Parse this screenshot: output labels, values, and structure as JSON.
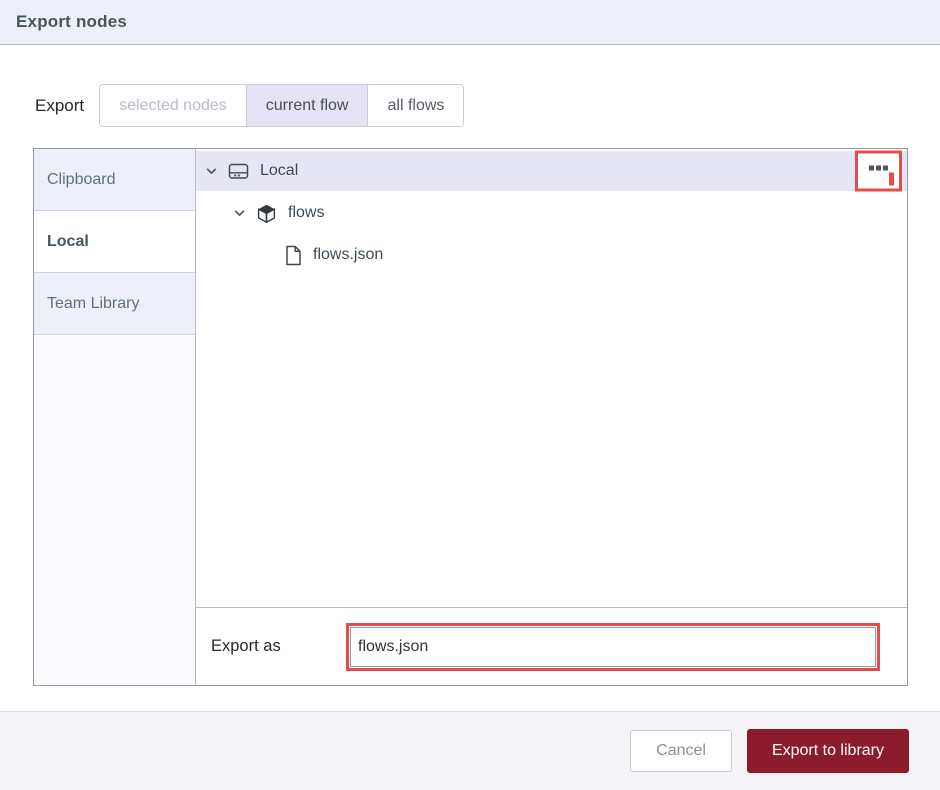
{
  "dialog": {
    "title": "Export nodes",
    "export_label": "Export",
    "scope_options": [
      {
        "label": "selected nodes",
        "state": "disabled"
      },
      {
        "label": "current flow",
        "state": "selected"
      },
      {
        "label": "all flows",
        "state": "normal"
      }
    ],
    "sidebar": {
      "tabs": [
        {
          "label": "Clipboard",
          "selected": false
        },
        {
          "label": "Local",
          "selected": true
        },
        {
          "label": "Team Library",
          "selected": false
        }
      ]
    },
    "tree": {
      "rows": [
        {
          "label": "Local",
          "icon": "hard-drive-icon",
          "expanded": true,
          "selected": true,
          "depth": 0
        },
        {
          "label": "flows",
          "icon": "cube-icon",
          "expanded": true,
          "selected": false,
          "depth": 1
        },
        {
          "label": "flows.json",
          "icon": "file-icon",
          "expanded": null,
          "selected": false,
          "depth": 2
        }
      ],
      "menu_icon": "ellipsis-icon"
    },
    "export_as": {
      "label": "Export as",
      "value": "flows.json"
    },
    "footer": {
      "cancel_label": "Cancel",
      "submit_label": "Export to library"
    },
    "colors": {
      "primary_button_red": "#8c1b2b",
      "annotation_red": "#e74c4c",
      "header_bg": "#eef0f9",
      "tab_bg": "#eef0f9",
      "selected_row_bg": "#e7e6f5",
      "selected_scope_bg": "#e4e2f3",
      "title_text": "#44565e"
    }
  }
}
